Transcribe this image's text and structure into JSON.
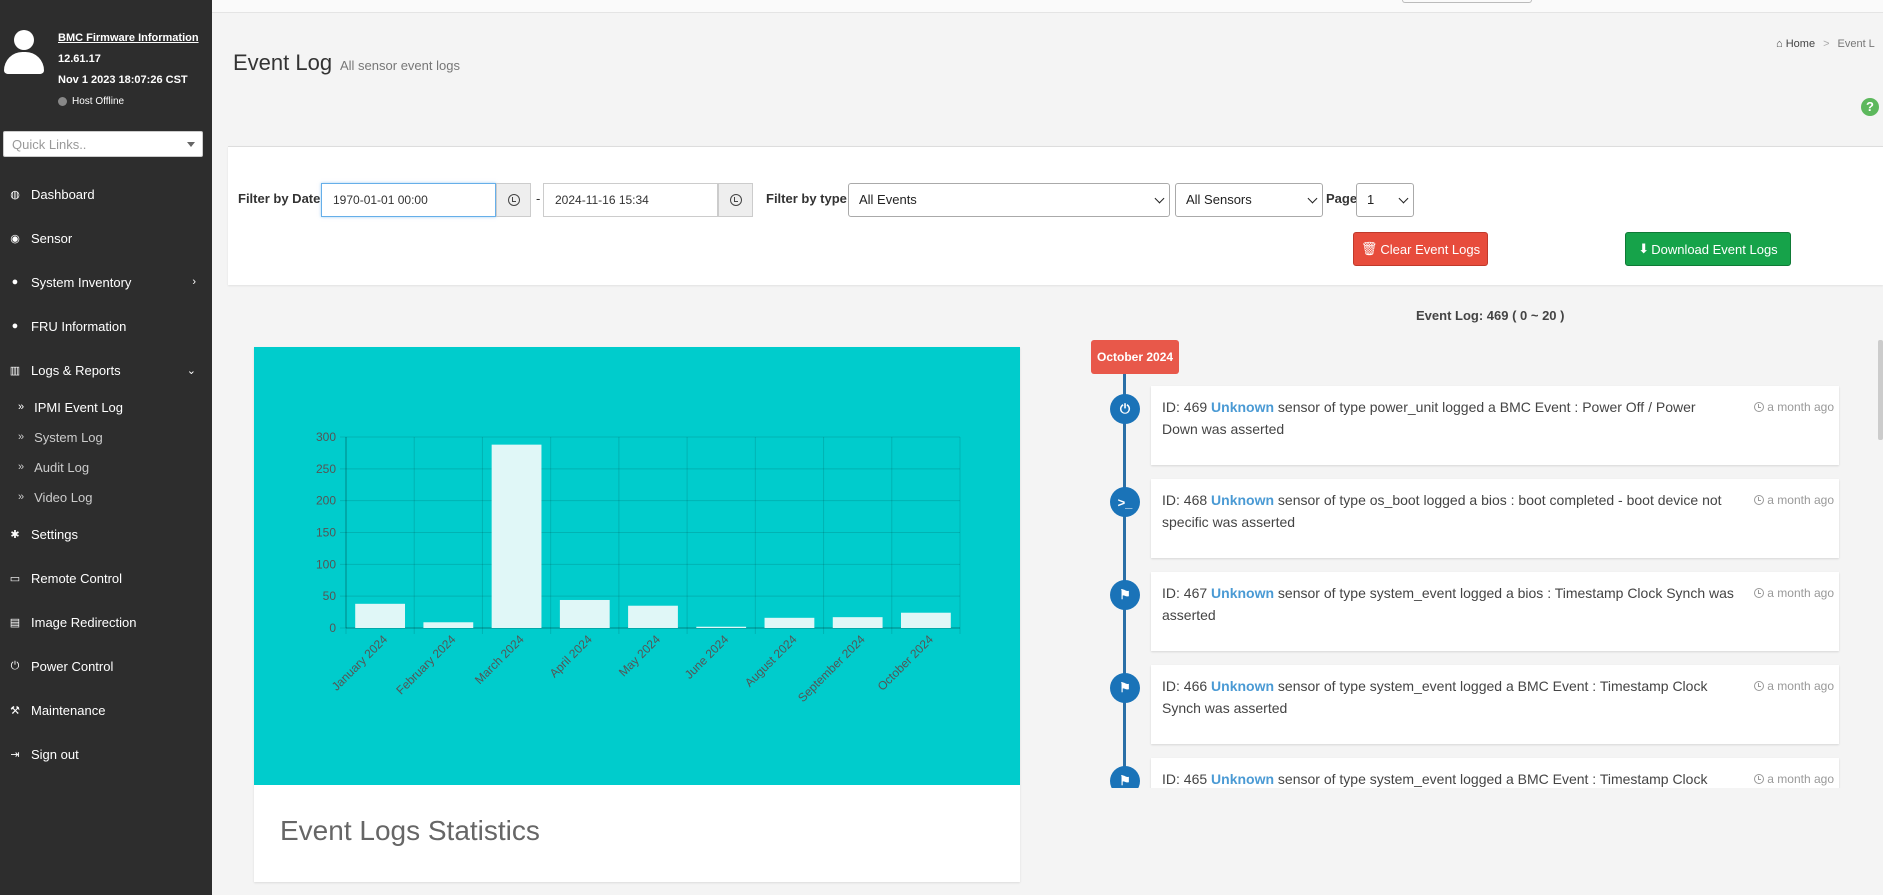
{
  "user": {
    "fw_label": "BMC Firmware Information",
    "fw_version": "12.61.17",
    "fw_date": "Nov 1 2023 18:07:26 CST",
    "host_status": "Host Offline"
  },
  "quick_links_placeholder": "Quick Links..",
  "nav": {
    "dashboard": "Dashboard",
    "sensor": "Sensor",
    "system_inventory": "System Inventory",
    "fru": "FRU Information",
    "logs_reports": "Logs & Reports",
    "ipmi_event_log": "IPMI Event Log",
    "system_log": "System Log",
    "audit_log": "Audit Log",
    "video_log": "Video Log",
    "settings": "Settings",
    "remote_control": "Remote Control",
    "image_redirection": "Image Redirection",
    "power_control": "Power Control",
    "maintenance": "Maintenance",
    "sign_out": "Sign out"
  },
  "header": {
    "title": "Event Log",
    "subtitle": "All sensor event logs",
    "breadcrumb_home": "Home",
    "breadcrumb_current": "Event L"
  },
  "filter": {
    "date_label": "Filter by Date",
    "date_from": "1970-01-01 00:00",
    "dash": "-",
    "date_to": "2024-11-16 15:34",
    "type_label": "Filter by type",
    "type_value": "All Events",
    "sensor_value": "All Sensors",
    "page_label": "Page",
    "page_value": "1",
    "clear_button": "Clear Event Logs",
    "download_button": "Download Event Logs"
  },
  "event_count": "Event Log: 469 ( 0 ~ 20 )",
  "chart_title": "Event Logs Statistics",
  "chart_data": {
    "type": "bar",
    "categories": [
      "January 2024",
      "February 2024",
      "March 2024",
      "April 2024",
      "May 2024",
      "June 2024",
      "August 2024",
      "September 2024",
      "October 2024"
    ],
    "values": [
      38,
      9,
      288,
      44,
      35,
      2,
      16,
      17,
      24
    ],
    "ylim": [
      0,
      300
    ],
    "yticks": [
      0,
      50,
      100,
      150,
      200,
      250,
      300
    ],
    "grid": true,
    "colors": {
      "background": "#00cccc",
      "bar": "#e0f7f7"
    }
  },
  "timeline": {
    "month": "October 2024",
    "events": [
      {
        "id": "ID: 469",
        "sensor": "Unknown",
        "text": "sensor of type power_unit logged a BMC Event : Power Off / Power Down was asserted",
        "time": "a month ago",
        "icon": "power-icon"
      },
      {
        "id": "ID: 468",
        "sensor": "Unknown",
        "text": "sensor of type os_boot logged a bios : boot completed - boot device not specific was asserted",
        "time": "a month ago",
        "icon": "terminal-icon"
      },
      {
        "id": "ID: 467",
        "sensor": "Unknown",
        "text": "sensor of type system_event logged a bios : Timestamp Clock Synch was asserted",
        "time": "a month ago",
        "icon": "flag-icon"
      },
      {
        "id": "ID: 466",
        "sensor": "Unknown",
        "text": "sensor of type system_event logged a BMC Event : Timestamp Clock Synch was asserted",
        "time": "a month ago",
        "icon": "flag-icon"
      },
      {
        "id": "ID: 465",
        "sensor": "Unknown",
        "text": "sensor of type system_event logged a BMC Event : Timestamp Clock",
        "time": "a month ago",
        "icon": "flag-icon"
      }
    ]
  }
}
